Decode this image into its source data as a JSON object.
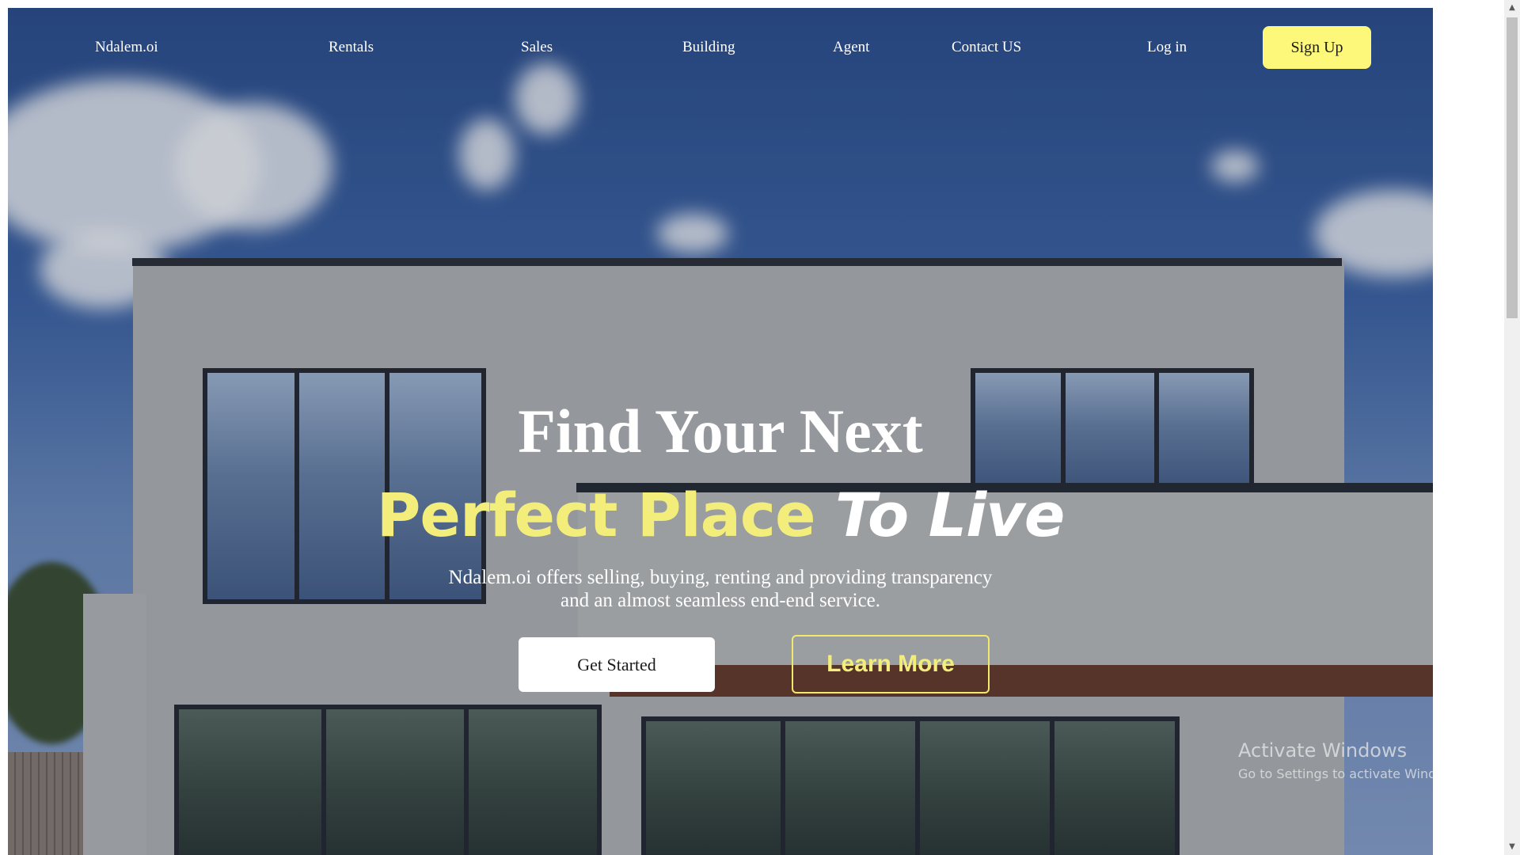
{
  "nav": {
    "brand": "Ndalem.oi",
    "links": [
      "Rentals",
      "Sales",
      "Building",
      "Agent",
      "Contact US"
    ],
    "login": "Log in",
    "signup": "Sign Up"
  },
  "hero": {
    "headline_line1": "Find Your Next",
    "headline_highlight": "Perfect Place",
    "headline_rest": "To Live",
    "subtext_line1": "Ndalem.oi offers selling, buying, renting and providing transparency",
    "subtext_line2": "and an almost seamless end-end service.",
    "primary_button": "Get Started",
    "secondary_button": "Learn More"
  },
  "system": {
    "activation_title": "Activate Windows",
    "activation_subtitle": "Go to Settings to activate Windows."
  },
  "colors": {
    "accent_yellow": "#fdf77a",
    "headline_yellow": "#f3ee7c",
    "sky_blue": "#2c4f8e"
  }
}
